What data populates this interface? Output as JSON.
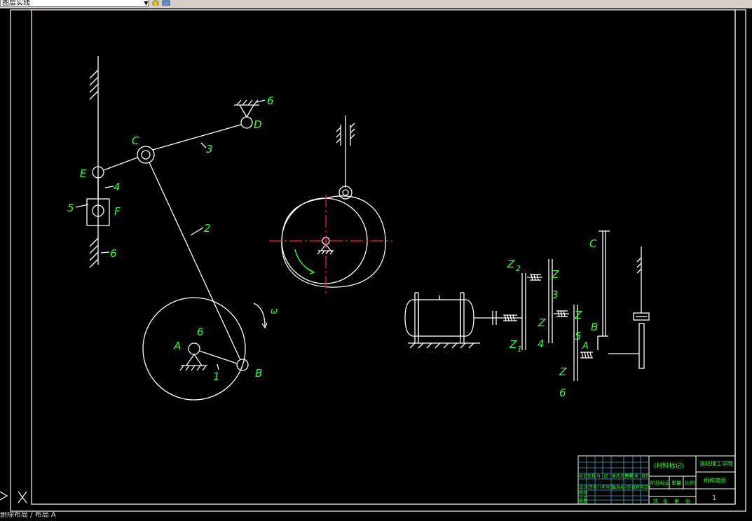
{
  "toolbar": {
    "layer_combo_value": "图层实线",
    "layer_combo_arrow": "▼",
    "icons": [
      "layer-light-icon",
      "layer-freeze-icon",
      "layer-tool-icon"
    ]
  },
  "colors": {
    "background": "#000000",
    "linework": "#ffffff",
    "labels": "#33ff33",
    "centerline": "#ff2020",
    "frame": "#ffffff"
  },
  "linkage": {
    "labels": {
      "C": "C",
      "D": "D",
      "E": "E",
      "F": "F",
      "A": "A",
      "B": "B",
      "n6_top": "6",
      "n3": "3",
      "n4": "4",
      "n5": "5",
      "n6_left": "6",
      "n2": "2",
      "n6_center": "6",
      "n1": "1",
      "omega": "ω"
    }
  },
  "gear_train": {
    "labels": {
      "Z2": "Z",
      "Z2_sub": "2",
      "Z_a": "Z",
      "n3": "3",
      "Z_b": "Z",
      "Z_c": "Z",
      "n4": "4",
      "n5": "5",
      "Z1": "Z",
      "Z1_sub": "1",
      "C": "C",
      "B": "B",
      "A": "A",
      "Z_d": "Z",
      "n6": "6"
    }
  },
  "title_block": {
    "material": "(材料标记)",
    "school": "洛阳理工学院",
    "drawing_name": "机构简图",
    "sheet_no": "1",
    "row1": [
      "标记",
      "处数",
      "分",
      "区",
      "更改文件号",
      "签名",
      "年",
      "月",
      "日"
    ],
    "row2_left": [
      "设计",
      "(签名)",
      "(年月日)",
      "标准化",
      "(签名)",
      "(年月日)"
    ],
    "row2_right": [
      "阶段标记",
      "重量",
      "比例"
    ],
    "row3_left": [
      "审核"
    ],
    "row4_left": [
      "工艺",
      "批准"
    ],
    "row4_right": [
      "共",
      "张",
      "第",
      "张"
    ]
  },
  "command_line": {
    "prompt": "删除布局 / 布局 A"
  }
}
